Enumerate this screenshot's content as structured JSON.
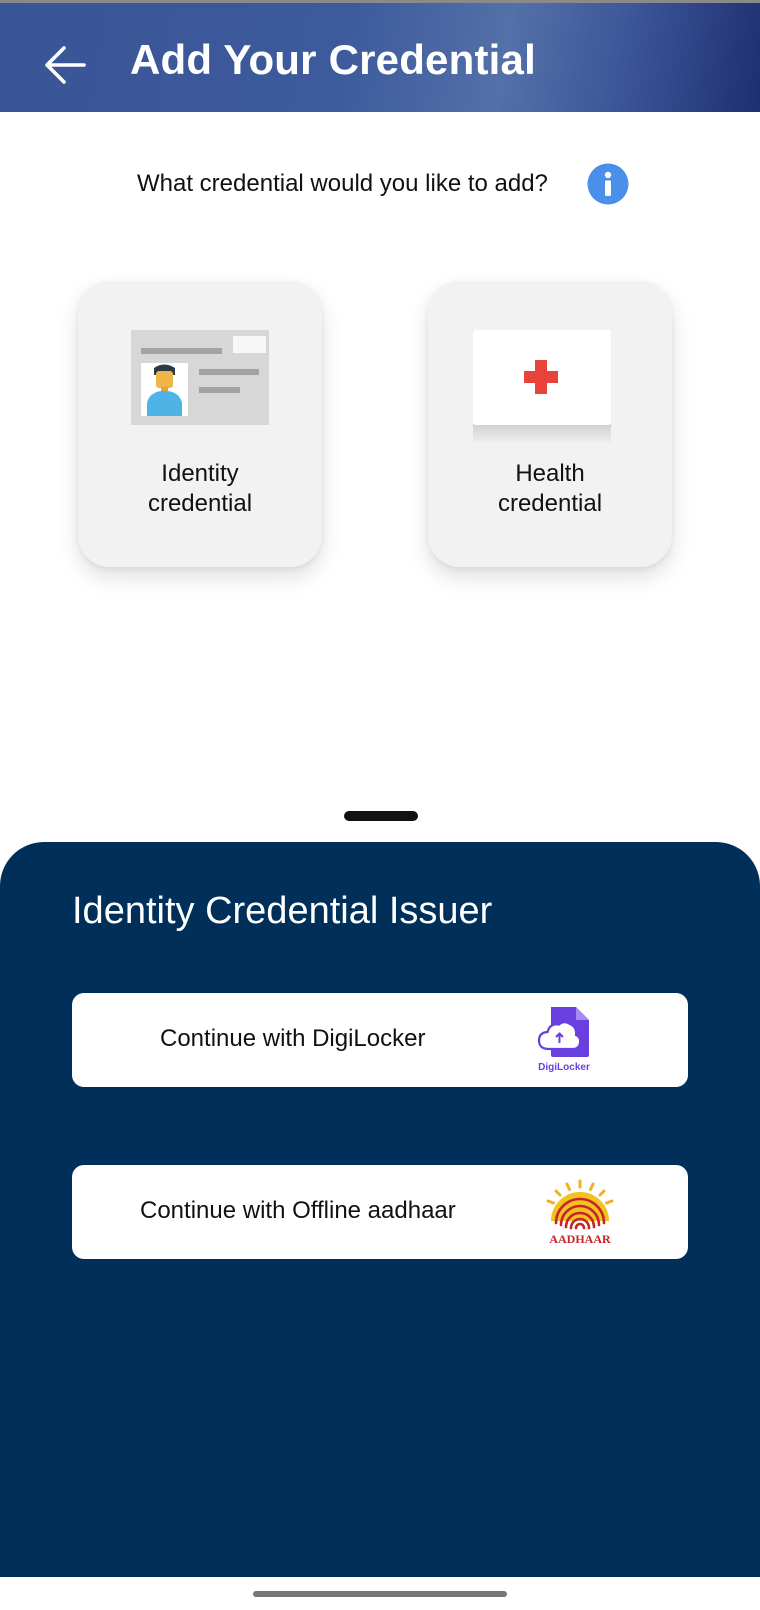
{
  "header": {
    "title": "Add Your Credential",
    "back_icon": "arrow-left-icon",
    "background": "#3d5a9c"
  },
  "main": {
    "question": "What credential would you like to add?",
    "info_icon": "info-icon",
    "info_icon_color": "#4a8fea",
    "cards": [
      {
        "line1": "Identity",
        "line2": "credential",
        "icon": "id-card-icon"
      },
      {
        "line1": "Health",
        "line2": "credential",
        "icon": "medical-cross-icon"
      }
    ]
  },
  "sheet": {
    "title": "Identity Credential Issuer",
    "background": "#002f5a",
    "buttons": [
      {
        "label": "Continue with DigiLocker",
        "logo": "digilocker-logo",
        "logo_text": "DigiLocker"
      },
      {
        "label": "Continue with Offline aadhaar",
        "logo": "aadhaar-logo",
        "logo_text": "AADHAAR"
      }
    ]
  }
}
